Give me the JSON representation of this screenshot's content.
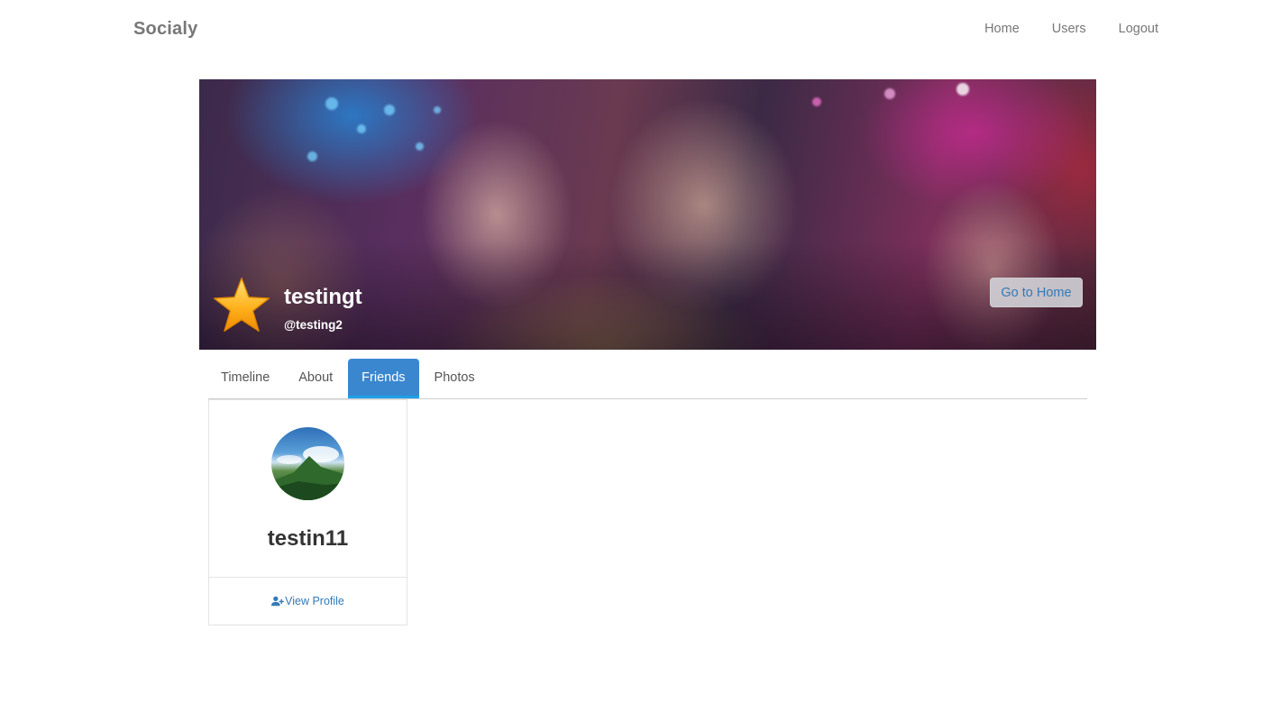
{
  "navbar": {
    "brand": "Socialy",
    "links": [
      {
        "label": "Home"
      },
      {
        "label": "Users"
      },
      {
        "label": "Logout"
      }
    ]
  },
  "cover": {
    "name": "testingt",
    "handle": "@testing2",
    "go_home_label": "Go to Home",
    "badge_icon": "star-icon"
  },
  "tabs": [
    {
      "label": "Timeline",
      "active": false
    },
    {
      "label": "About",
      "active": false
    },
    {
      "label": "Friends",
      "active": true
    },
    {
      "label": "Photos",
      "active": false
    }
  ],
  "friends": [
    {
      "name": "testin11",
      "action_label": "View Profile",
      "action_icon": "user-plus-icon"
    }
  ],
  "colors": {
    "accent": "#3a87cf",
    "link": "#337ab7",
    "nav_text": "#777777"
  }
}
